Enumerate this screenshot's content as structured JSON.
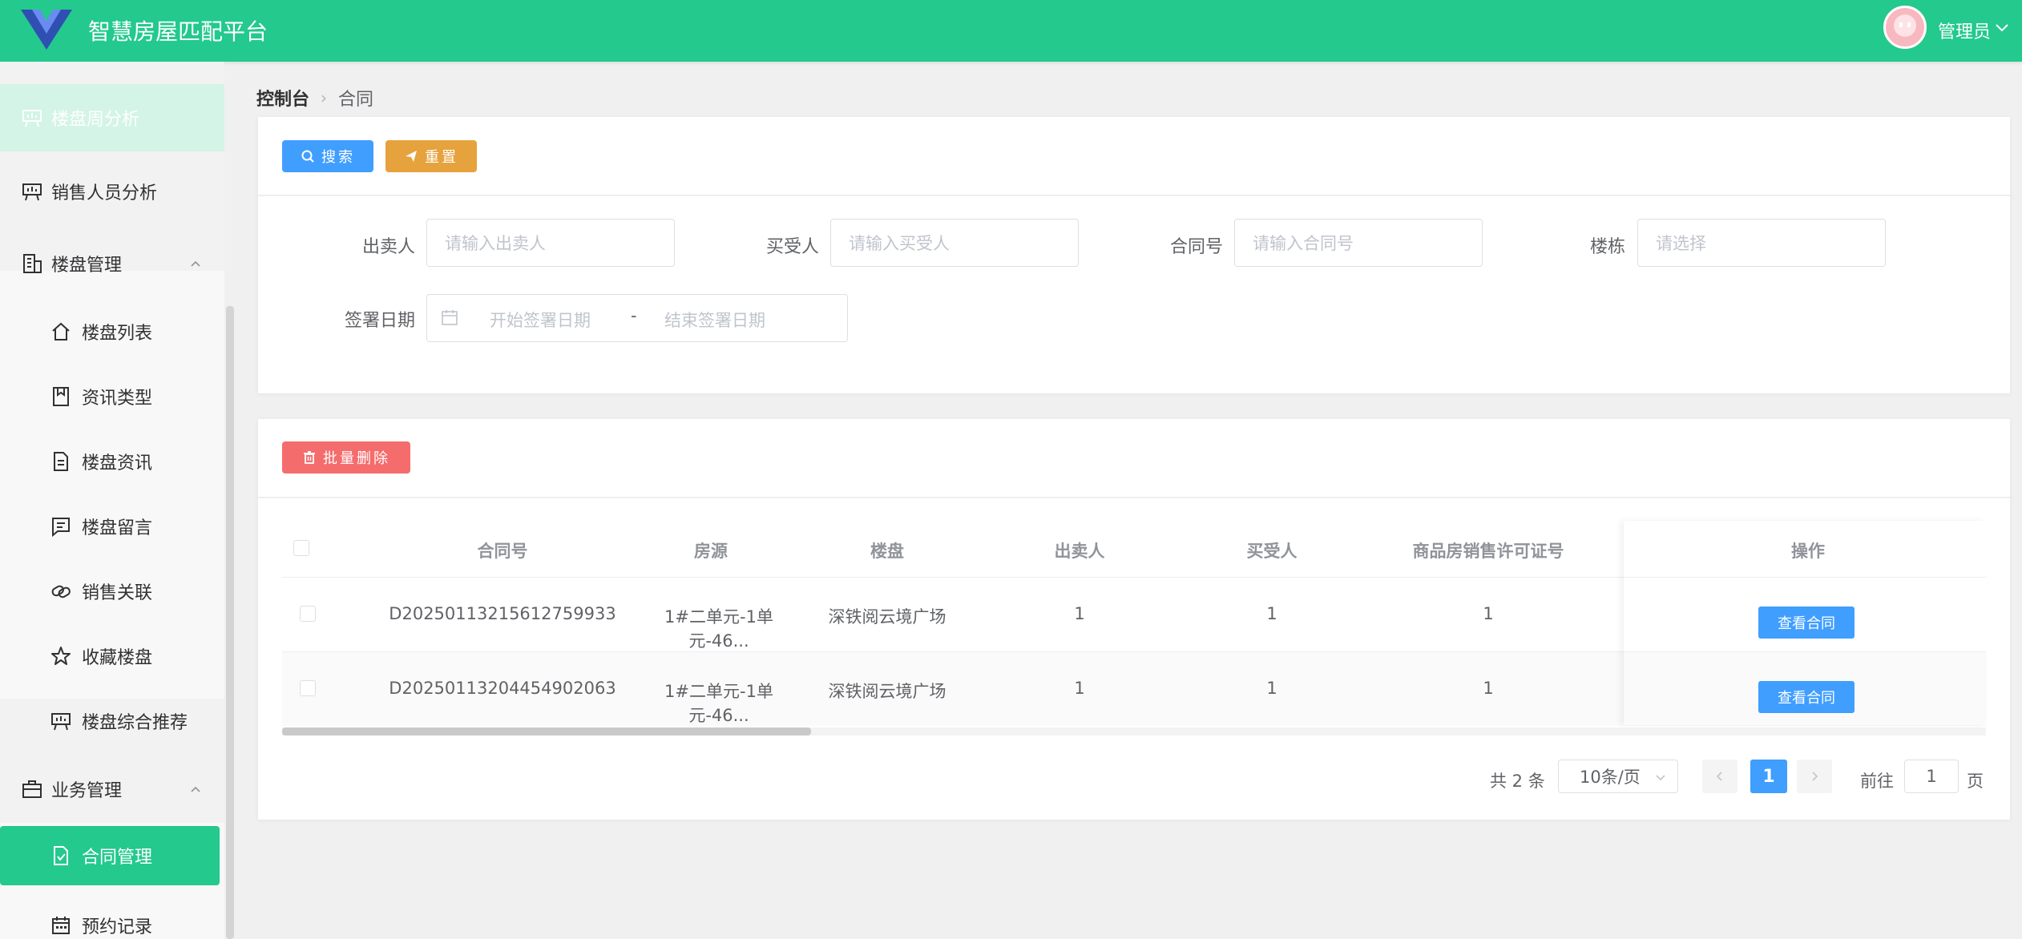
{
  "header": {
    "app_title": "智慧房屋匹配平台",
    "user_name": "管理员"
  },
  "sidebar": {
    "items": [
      {
        "label": "楼盘周分析",
        "icon": "presentation-icon"
      },
      {
        "label": "销售人员分析",
        "icon": "presentation-icon"
      },
      {
        "label": "楼盘管理",
        "icon": "building-icon"
      },
      {
        "label": "楼盘列表",
        "icon": "house-icon"
      },
      {
        "label": "资讯类型",
        "icon": "notebook-icon"
      },
      {
        "label": "楼盘资讯",
        "icon": "document-icon"
      },
      {
        "label": "楼盘留言",
        "icon": "chat-icon"
      },
      {
        "label": "销售关联",
        "icon": "link-icon"
      },
      {
        "label": "收藏楼盘",
        "icon": "star-icon"
      },
      {
        "label": "楼盘综合推荐",
        "icon": "presentation-icon"
      },
      {
        "label": "业务管理",
        "icon": "briefcase-icon"
      },
      {
        "label": "合同管理",
        "icon": "contract-icon"
      },
      {
        "label": "预约记录",
        "icon": "calendar-icon"
      }
    ]
  },
  "breadcrumb": {
    "home": "控制台",
    "current": "合同"
  },
  "toolbar": {
    "search_label": "搜索",
    "reset_label": "重置",
    "batch_delete_label": "批量删除"
  },
  "filters": {
    "seller": {
      "label": "出卖人",
      "placeholder": "请输入出卖人"
    },
    "buyer": {
      "label": "买受人",
      "placeholder": "请输入买受人"
    },
    "contract_no": {
      "label": "合同号",
      "placeholder": "请输入合同号"
    },
    "building": {
      "label": "楼栋",
      "placeholder": "请选择"
    },
    "sign_date": {
      "label": "签署日期",
      "start_placeholder": "开始签署日期",
      "separator": "-",
      "end_placeholder": "结束签署日期"
    }
  },
  "table": {
    "columns": [
      "合同号",
      "房源",
      "楼盘",
      "出卖人",
      "买受人",
      "商品房销售许可证号",
      "操作"
    ],
    "rows": [
      {
        "contract_no": "D20250113215612759933",
        "house": "1#二单元-1单元-46...",
        "estate": "深铁阅云境广场",
        "seller": "1",
        "buyer": "1",
        "license": "1",
        "action": "查看合同"
      },
      {
        "contract_no": "D20250113204454902063",
        "house": "1#二单元-1单元-46...",
        "estate": "深铁阅云境广场",
        "seller": "1",
        "buyer": "1",
        "license": "1",
        "action": "查看合同"
      }
    ]
  },
  "pagination": {
    "total_text": "共 2 条",
    "page_size": "10条/页",
    "current_page": "1",
    "goto_label": "前往",
    "goto_value": "1",
    "page_suffix": "页"
  },
  "colors": {
    "brand": "#23c98d",
    "primary": "#409eff",
    "warning": "#e6a23c",
    "danger": "#f56c6c"
  }
}
